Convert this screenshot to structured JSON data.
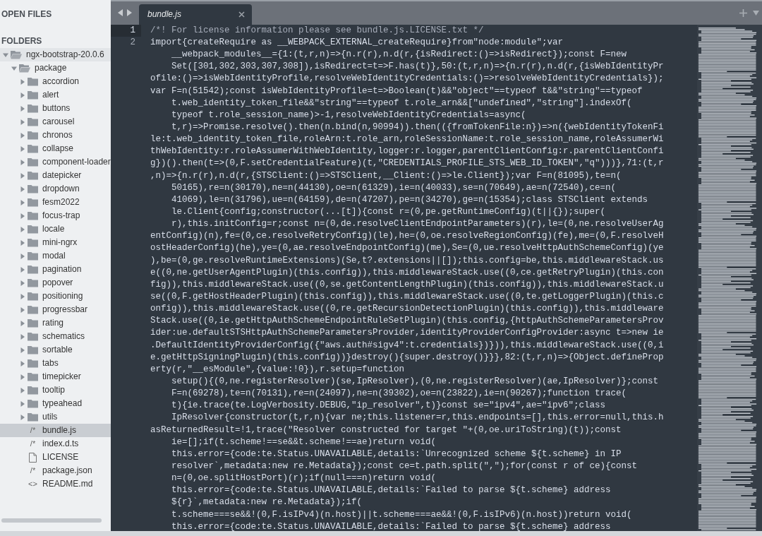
{
  "sidebar": {
    "open_files_heading": "OPEN FILES",
    "folders_heading": "FOLDERS",
    "tree": [
      {
        "name": "ngx-bootstrap-20.0.6",
        "kind": "folder",
        "expanded": true,
        "selected": false,
        "children": [
          {
            "name": "package",
            "kind": "folder",
            "expanded": true,
            "selected": false,
            "children": [
              {
                "name": "accordion",
                "kind": "folder",
                "expanded": false,
                "selected": false
              },
              {
                "name": "alert",
                "kind": "folder",
                "expanded": false,
                "selected": false
              },
              {
                "name": "buttons",
                "kind": "folder",
                "expanded": false,
                "selected": false
              },
              {
                "name": "carousel",
                "kind": "folder",
                "expanded": false,
                "selected": false
              },
              {
                "name": "chronos",
                "kind": "folder",
                "expanded": false,
                "selected": false
              },
              {
                "name": "collapse",
                "kind": "folder",
                "expanded": false,
                "selected": false
              },
              {
                "name": "component-loader",
                "kind": "folder",
                "expanded": false,
                "selected": false
              },
              {
                "name": "datepicker",
                "kind": "folder",
                "expanded": false,
                "selected": false
              },
              {
                "name": "dropdown",
                "kind": "folder",
                "expanded": false,
                "selected": false
              },
              {
                "name": "fesm2022",
                "kind": "folder",
                "expanded": false,
                "selected": false
              },
              {
                "name": "focus-trap",
                "kind": "folder",
                "expanded": false,
                "selected": false
              },
              {
                "name": "locale",
                "kind": "folder",
                "expanded": false,
                "selected": false
              },
              {
                "name": "mini-ngrx",
                "kind": "folder",
                "expanded": false,
                "selected": false
              },
              {
                "name": "modal",
                "kind": "folder",
                "expanded": false,
                "selected": false
              },
              {
                "name": "pagination",
                "kind": "folder",
                "expanded": false,
                "selected": false
              },
              {
                "name": "popover",
                "kind": "folder",
                "expanded": false,
                "selected": false
              },
              {
                "name": "positioning",
                "kind": "folder",
                "expanded": false,
                "selected": false
              },
              {
                "name": "progressbar",
                "kind": "folder",
                "expanded": false,
                "selected": false
              },
              {
                "name": "rating",
                "kind": "folder",
                "expanded": false,
                "selected": false
              },
              {
                "name": "schematics",
                "kind": "folder",
                "expanded": false,
                "selected": false
              },
              {
                "name": "sortable",
                "kind": "folder",
                "expanded": false,
                "selected": false
              },
              {
                "name": "tabs",
                "kind": "folder",
                "expanded": false,
                "selected": false
              },
              {
                "name": "timepicker",
                "kind": "folder",
                "expanded": false,
                "selected": false
              },
              {
                "name": "tooltip",
                "kind": "folder",
                "expanded": false,
                "selected": false
              },
              {
                "name": "typeahead",
                "kind": "folder",
                "expanded": false,
                "selected": false
              },
              {
                "name": "utils",
                "kind": "folder",
                "expanded": false,
                "selected": false
              },
              {
                "name": "bundle.js",
                "kind": "file",
                "glyph": "/*",
                "selected": true
              },
              {
                "name": "index.d.ts",
                "kind": "file",
                "glyph": "/*",
                "selected": false
              },
              {
                "name": "LICENSE",
                "kind": "document",
                "selected": false
              },
              {
                "name": "package.json",
                "kind": "file",
                "glyph": "/*",
                "selected": false
              },
              {
                "name": "README.md",
                "kind": "file",
                "glyph": "<>",
                "selected": false
              }
            ]
          }
        ]
      }
    ]
  },
  "tabs": [
    {
      "title": "bundle.js",
      "selected": true
    }
  ],
  "editor": {
    "lines": [
      {
        "number": "1",
        "highlighted": true,
        "rows": [
          {
            "text": "/*! For license information please see bundle.js.LICENSE.txt */",
            "kind": "comment",
            "indented": false
          }
        ]
      },
      {
        "number": "2",
        "highlighted": false,
        "rows": [
          {
            "text": "import{createRequire as __WEBPACK_EXTERNAL_createRequire}from\"node:module\";var",
            "kind": "code",
            "indented": false
          },
          {
            "text": "__webpack_modules__={1:(t,r,n)=>{n.r(r),n.d(r,{isRedirect:()=>isRedirect});const F=new",
            "kind": "code",
            "indented": true
          },
          {
            "text": "Set([301,302,303,307,308]),isRedirect=t=>F.has(t)},50:(t,r,n)=>{n.r(r),n.d(r,{isWebIdentityPr",
            "kind": "code",
            "indented": true
          },
          {
            "text": "ofile:()=>isWebIdentityProfile,resolveWebIdentityCredentials:()=>resolveWebIdentityCredentials});",
            "kind": "code",
            "indented": false
          },
          {
            "text": "var F=n(51542);const isWebIdentityProfile=t=>Boolean(t)&&\"object\"==typeof t&&\"string\"==typeof",
            "kind": "code",
            "indented": false
          },
          {
            "text": "t.web_identity_token_file&&\"string\"==typeof t.role_arn&&[\"undefined\",\"string\"].indexOf(",
            "kind": "code",
            "indented": true
          },
          {
            "text": "typeof t.role_session_name)>-1,resolveWebIdentityCredentials=async(",
            "kind": "code",
            "indented": true
          },
          {
            "text": "t,r)=>Promise.resolve().then(n.bind(n,90994)).then(({fromTokenFile:n})=>n({webIdentityTokenFi",
            "kind": "code",
            "indented": true
          },
          {
            "text": "le:t.web_identity_token_file,roleArn:t.role_arn,roleSessionName:t.role_session_name,roleAssumerWi",
            "kind": "code",
            "indented": false
          },
          {
            "text": "thWebIdentity:r.roleAssumerWithWebIdentity,logger:r.logger,parentClientConfig:r.parentClientConfi",
            "kind": "code",
            "indented": false
          },
          {
            "text": "g})().then(t=>(0,F.setCredentialFeature)(t,\"CREDENTIALS_PROFILE_STS_WEB_ID_TOKEN\",\"q\")))},71:(t,r",
            "kind": "code",
            "indented": false
          },
          {
            "text": ",n)=>{n.r(r),n.d(r,{STSClient:()=>STSClient,__Client:()=>le.Client});var F=n(81095),te=n(",
            "kind": "code",
            "indented": false
          },
          {
            "text": "50165),re=n(30170),ne=n(44130),oe=n(61329),ie=n(40033),se=n(70649),ae=n(72540),ce=n(",
            "kind": "code",
            "indented": true
          },
          {
            "text": "41069),le=n(31796),ue=n(64159),de=n(47207),pe=n(34270),ge=n(15354);class STSClient extends",
            "kind": "code",
            "indented": true
          },
          {
            "text": "le.Client{config;constructor(...[t]){const r=(0,pe.getRuntimeConfig)(t||{});super(",
            "kind": "code",
            "indented": true
          },
          {
            "text": "r),this.initConfig=r;const n=(0,de.resolveClientEndpointParameters)(r),le=(0,ne.resolveUserAg",
            "kind": "code",
            "indented": true
          },
          {
            "text": "entConfig)(n),fe=(0,ce.resolveRetryConfig)(le),he=(0,oe.resolveRegionConfig)(fe),me=(0,F.resolveH",
            "kind": "code",
            "indented": false
          },
          {
            "text": "ostHeaderConfig)(he),ye=(0,ae.resolveEndpointConfig)(me),Se=(0,ue.resolveHttpAuthSchemeConfig)(ye",
            "kind": "code",
            "indented": false
          },
          {
            "text": "),be=(0,ge.resolveRuntimeExtensions)(Se,t?.extensions||[]);this.config=be,this.middlewareStack.us",
            "kind": "code",
            "indented": false
          },
          {
            "text": "e((0,ne.getUserAgentPlugin)(this.config)),this.middlewareStack.use((0,ce.getRetryPlugin)(this.con",
            "kind": "code",
            "indented": false
          },
          {
            "text": "fig)),this.middlewareStack.use((0,se.getContentLengthPlugin)(this.config)),this.middlewareStack.u",
            "kind": "code",
            "indented": false
          },
          {
            "text": "se((0,F.getHostHeaderPlugin)(this.config)),this.middlewareStack.use((0,te.getLoggerPlugin)(this.c",
            "kind": "code",
            "indented": false
          },
          {
            "text": "onfig)),this.middlewareStack.use((0,re.getRecursionDetectionPlugin)(this.config)),this.middleware",
            "kind": "code",
            "indented": false
          },
          {
            "text": "Stack.use((0,ie.getHttpAuthSchemeEndpointRuleSetPlugin)(this.config,{httpAuthSchemeParametersProv",
            "kind": "code",
            "indented": false
          },
          {
            "text": "ider:ue.defaultSTSHttpAuthSchemeParametersProvider,identityProviderConfigProvider:async t=>new ie",
            "kind": "code",
            "indented": false
          },
          {
            "text": ".DefaultIdentityProviderConfig({\"aws.auth#sigv4\":t.credentials})})),this.middlewareStack.use((0,i",
            "kind": "code",
            "indented": false
          },
          {
            "text": "e.getHttpSigningPlugin)(this.config))}destroy(){super.destroy()}}},82:(t,r,n)=>{Object.defineProp",
            "kind": "code",
            "indented": false
          },
          {
            "text": "erty(r,\"__esModule\",{value:!0}),r.setup=function",
            "kind": "code",
            "indented": false
          },
          {
            "text": "setup(){(0,ne.registerResolver)(se,IpResolver),(0,ne.registerResolver)(ae,IpResolver)};const",
            "kind": "code",
            "indented": true
          },
          {
            "text": "F=n(69278),te=n(70131),re=n(24097),ne=n(39302),oe=n(23822),ie=n(90267);function trace(",
            "kind": "code",
            "indented": true
          },
          {
            "text": "t){ie.trace(te.LogVerbosity.DEBUG,\"ip_resolver\",t)}const se=\"ipv4\",ae=\"ipv6\";class",
            "kind": "code",
            "indented": true
          },
          {
            "text": "IpResolver{constructor(t,r,n){var ne;this.listener=r,this.endpoints=[],this.error=null,this.h",
            "kind": "code",
            "indented": true
          },
          {
            "text": "asReturnedResult=!1,trace(\"Resolver constructed for target \"+(0,oe.uriToString)(t));const",
            "kind": "code",
            "indented": false
          },
          {
            "text": "ie=[];if(t.scheme!==se&&t.scheme!==ae)return void(",
            "kind": "code",
            "indented": true
          },
          {
            "text": "this.error={code:te.Status.UNAVAILABLE,details:`Unrecognized scheme ${t.scheme} in IP",
            "kind": "code",
            "indented": true
          },
          {
            "text": "resolver`,metadata:new re.Metadata});const ce=t.path.split(\",\");for(const r of ce){const",
            "kind": "code",
            "indented": true
          },
          {
            "text": "n=(0,oe.splitHostPort)(r);if(null===n)return void(",
            "kind": "code",
            "indented": true
          },
          {
            "text": "this.error={code:te.Status.UNAVAILABLE,details:`Failed to parse ${t.scheme} address",
            "kind": "code",
            "indented": true
          },
          {
            "text": "${r}`,metadata:new re.Metadata});if(",
            "kind": "code",
            "indented": true
          },
          {
            "text": "t.scheme===se&&!(0,F.isIPv4)(n.host)||t.scheme===ae&&!(0,F.isIPv6)(n.host))return void(",
            "kind": "code",
            "indented": true
          },
          {
            "text": "this.error={code:te.Status.UNAVAILABLE,details:`Failed to parse ${t.scheme} address",
            "kind": "code",
            "indented": true
          }
        ]
      }
    ]
  }
}
